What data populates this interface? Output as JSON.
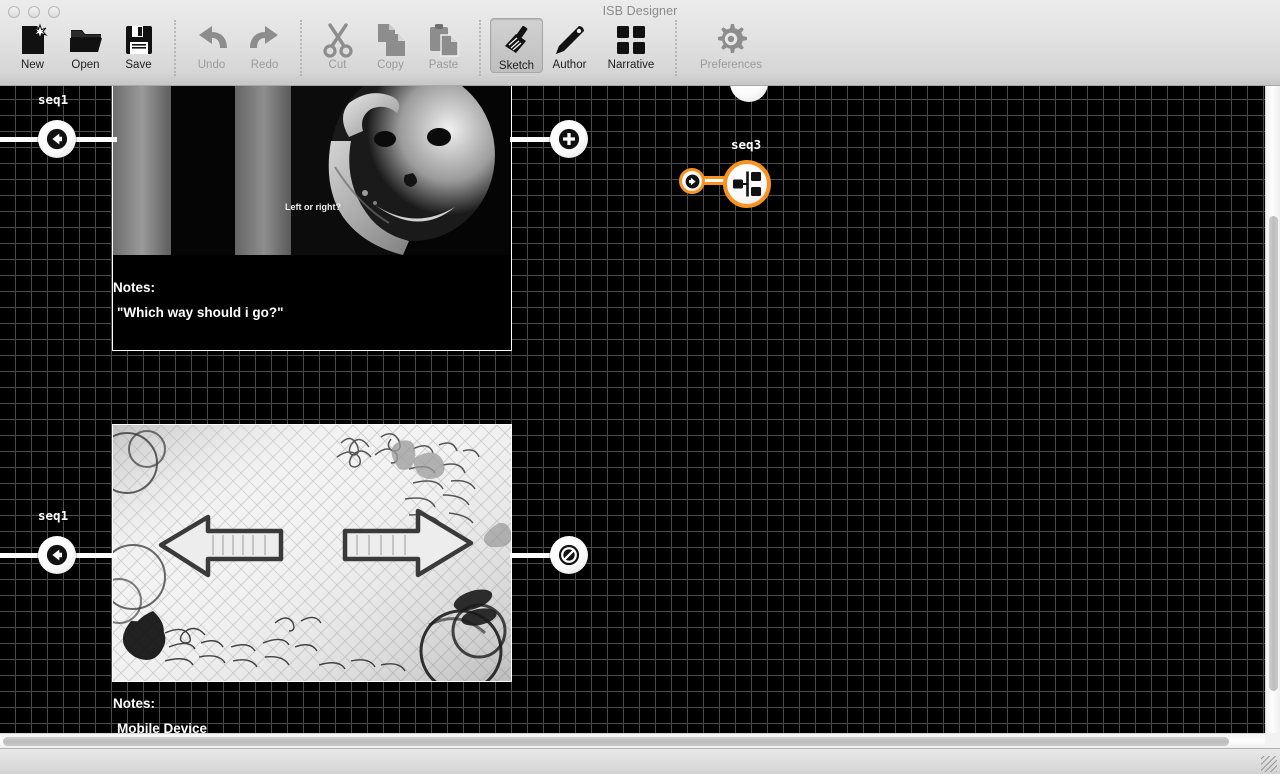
{
  "window": {
    "title": "ISB Designer",
    "traffic_lights": [
      "close-button",
      "minimize-button",
      "zoom-button"
    ]
  },
  "toolbar": {
    "groups": [
      {
        "name": "file",
        "items": [
          {
            "id": "new",
            "label": "New",
            "icon": "new-document-icon",
            "enabled": true,
            "active": false
          },
          {
            "id": "open",
            "label": "Open",
            "icon": "open-folder-icon",
            "enabled": true,
            "active": false
          },
          {
            "id": "save",
            "label": "Save",
            "icon": "floppy-disk-icon",
            "enabled": true,
            "active": false
          }
        ]
      },
      {
        "name": "history",
        "items": [
          {
            "id": "undo",
            "label": "Undo",
            "icon": "undo-arrow-icon",
            "enabled": false,
            "active": false
          },
          {
            "id": "redo",
            "label": "Redo",
            "icon": "redo-arrow-icon",
            "enabled": false,
            "active": false
          }
        ]
      },
      {
        "name": "clipboard",
        "items": [
          {
            "id": "cut",
            "label": "Cut",
            "icon": "scissors-icon",
            "enabled": false,
            "active": false
          },
          {
            "id": "copy",
            "label": "Copy",
            "icon": "copy-pages-icon",
            "enabled": false,
            "active": false
          },
          {
            "id": "paste",
            "label": "Paste",
            "icon": "clipboard-icon",
            "enabled": false,
            "active": false
          }
        ]
      },
      {
        "name": "modes",
        "items": [
          {
            "id": "sketch",
            "label": "Sketch",
            "icon": "paintbrush-icon",
            "enabled": true,
            "active": true
          },
          {
            "id": "author",
            "label": "Author",
            "icon": "pencil-icon",
            "enabled": true,
            "active": false
          },
          {
            "id": "narrative",
            "label": "Narrative",
            "icon": "grid-squares-icon",
            "enabled": true,
            "active": false
          }
        ]
      },
      {
        "name": "settings",
        "items": [
          {
            "id": "preferences",
            "label": "Preferences",
            "icon": "gear-icon",
            "enabled": false,
            "active": false
          }
        ]
      }
    ]
  },
  "canvas": {
    "grid_size_px": 16,
    "background_color": "#000000",
    "grid_line_color": "#4a4a4a",
    "accent_color": "#f79420",
    "nodes": [
      {
        "id": "node-seq1-top",
        "label": "seq1",
        "icon": "back-arrow-icon",
        "selected": false
      },
      {
        "id": "node-add-top",
        "label": "",
        "icon": "plus-circle-icon",
        "selected": false
      },
      {
        "id": "node-seq3",
        "label": "seq3",
        "icon": "branch-split-icon",
        "selected": true
      },
      {
        "id": "node-seq3-entry",
        "label": "",
        "icon": "forward-arrow-icon",
        "selected": true
      },
      {
        "id": "node-seq1-bottom",
        "label": "seq1",
        "icon": "back-arrow-icon",
        "selected": false
      },
      {
        "id": "node-stop-bottom",
        "label": "",
        "icon": "no-entry-icon",
        "selected": false
      }
    ],
    "scenes": [
      {
        "id": "scene-top",
        "notes_label": "Notes:",
        "notes_text": "\"Which way should i go?\"",
        "thumbnail": "black-and-white-photo-woman-on-phone",
        "caption_in_image": "Left or right?"
      },
      {
        "id": "scene-bottom",
        "notes_label": "Notes:",
        "notes_text": "Mobile Device",
        "thumbnail": "sketch-two-arrows-left-and-right"
      }
    ]
  },
  "scrollbars": {
    "vertical": {
      "name": "vertical-scrollbar",
      "thumb_top_pct": 22,
      "thumb_height_pct": 70
    },
    "horizontal": {
      "name": "horizontal-scrollbar",
      "thumb_left_pct": 0,
      "thumb_width_pct": 96
    }
  }
}
